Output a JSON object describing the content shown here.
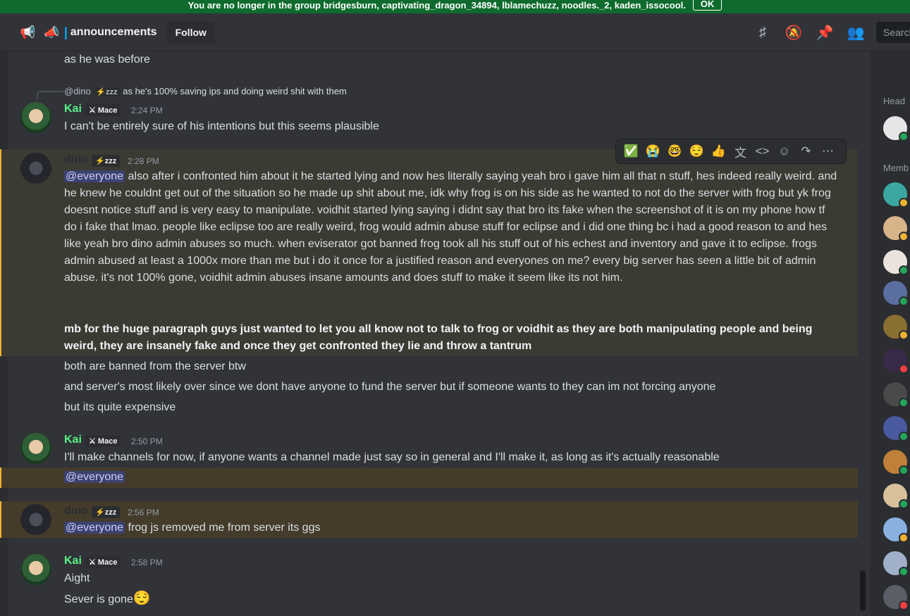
{
  "notice": {
    "text": "You are no longer in the group bridgesburn, captivating_dragon_34894, lblamechuzz, noodles._2, kaden_issocool.",
    "ok_label": "OK"
  },
  "header": {
    "channel": "announcements",
    "follow_label": "Follow",
    "search_placeholder": "Search",
    "icons": [
      "threads-icon",
      "notification-mute-icon",
      "pin-icon",
      "members-icon"
    ]
  },
  "messages": {
    "m0": {
      "text": "as he was before"
    },
    "m1": {
      "reply_author": "@dino",
      "reply_tag": "zzz",
      "reply_text": "as he's 100% saving ips and doing weird shit with them",
      "author": "Kai",
      "tag": "Mace",
      "time": "2:24 PM",
      "text": "I can't be entirely sure of his intentions but this seems plausible"
    },
    "m2": {
      "author": "dino",
      "tag": "zzz",
      "time": "2:28 PM",
      "mention": "@everyone",
      "text": " also after i confronted him about it he started lying and now hes literally saying yeah bro i gave him all that n stuff, hes indeed really weird. and he knew he couldnt get out of the situation so he made up shit about me, idk why frog is on his side as he wanted to not do the server with frog but yk frog doesnt notice stuff and is very easy to manipulate. voidhit started lying saying i didnt say that bro its fake when the screenshot of it is on my phone how tf do i fake that lmao. people like eclipse too are really weird, frog would admin abuse stuff for eclipse and i did one thing bc i had a good reason to and hes like yeah bro dino admin abuses so much. when eviserator got banned frog took all his stuff out of his echest and inventory and gave it to eclipse. frogs admin abused at least a 1000x more than me but i do it once for a justified reason and everyones on me? every big server has seen a little bit of admin abuse. it's not 100% gone, voidhit admin abuses insane amounts and does stuff to make it seem like its not him.",
      "bold_text": "mb for the huge paragraph guys just wanted to let you all know not to talk to frog or voidhit as they are both manipulating people and being weird, they are insanely fake and once they get confronted they lie and throw a tantrum"
    },
    "m3": {
      "text": "both are banned from the server btw"
    },
    "m4": {
      "text": "and server's most likely over since we dont have anyone to fund the server but if someone wants to they can im not forcing anyone"
    },
    "m5": {
      "text": "but its quite expensive"
    },
    "m6": {
      "author": "Kai",
      "tag": "Mace",
      "time": "2:50 PM",
      "text": "I'll make channels for now, if anyone wants a channel made just say so in general and I'll make it, as long as it's actually reasonable"
    },
    "m7": {
      "mention": "@everyone"
    },
    "m8": {
      "author": "dino",
      "tag": "zzz",
      "time": "2:56 PM",
      "mention": "@everyone",
      "text": " frog js removed me from server its ggs"
    },
    "m9": {
      "author": "Kai",
      "tag": "Mace",
      "time": "2:58 PM",
      "text": "Aight"
    },
    "m10": {
      "text": "Sever is gone",
      "emoji": "😌"
    }
  },
  "toolbar": {
    "reactions": [
      "✅",
      "😭",
      "🤓",
      "😌",
      "👍"
    ],
    "icons": [
      "translate-icon",
      "code-icon",
      "add-reaction-icon",
      "reply-forward-icon",
      "more-icon"
    ]
  },
  "members": {
    "head_label": "Head",
    "members_label": "Memb"
  },
  "colors": {
    "kai_name": "#57f287",
    "mention_bg": "#3c4270",
    "highlight_border": "#f0b132",
    "notice_bg": "#0e6b2d"
  }
}
